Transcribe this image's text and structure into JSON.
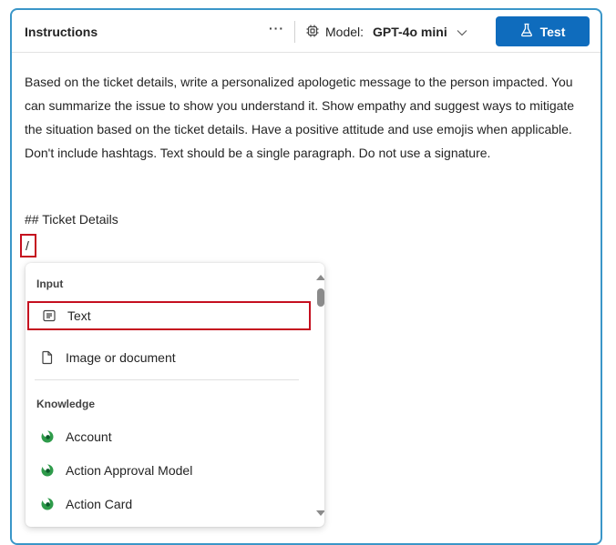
{
  "header": {
    "title": "Instructions",
    "more_label": "···",
    "model_label": "Model:",
    "model_value": "GPT-4o mini",
    "test_label": "Test"
  },
  "body": {
    "paragraph": "Based on the ticket details, write a personalized apologetic message to the person impacted. You can summarize the issue to show you understand it. Show empathy and suggest ways to mitigate the situation based on the ticket details. Have a positive attitude and use emojis when applicable. Don't include hashtags. Text should be a single paragraph. Do not use a signature.",
    "ticket_heading": "## Ticket Details",
    "slash": "/"
  },
  "dropdown": {
    "input_section": "Input",
    "input_items": [
      {
        "label": "Text",
        "icon": "text-doc-icon"
      },
      {
        "label": "Image or document",
        "icon": "document-icon"
      }
    ],
    "knowledge_section": "Knowledge",
    "knowledge_items": [
      {
        "label": "Account",
        "icon": "dataverse-icon"
      },
      {
        "label": "Action Approval Model",
        "icon": "dataverse-icon"
      },
      {
        "label": "Action Card",
        "icon": "dataverse-icon"
      }
    ]
  },
  "colors": {
    "accent": "#0f6cbd",
    "panel_border": "#3a96c8",
    "highlight_red": "#c50f1f",
    "dataverse_green": "#2e9b4a"
  }
}
